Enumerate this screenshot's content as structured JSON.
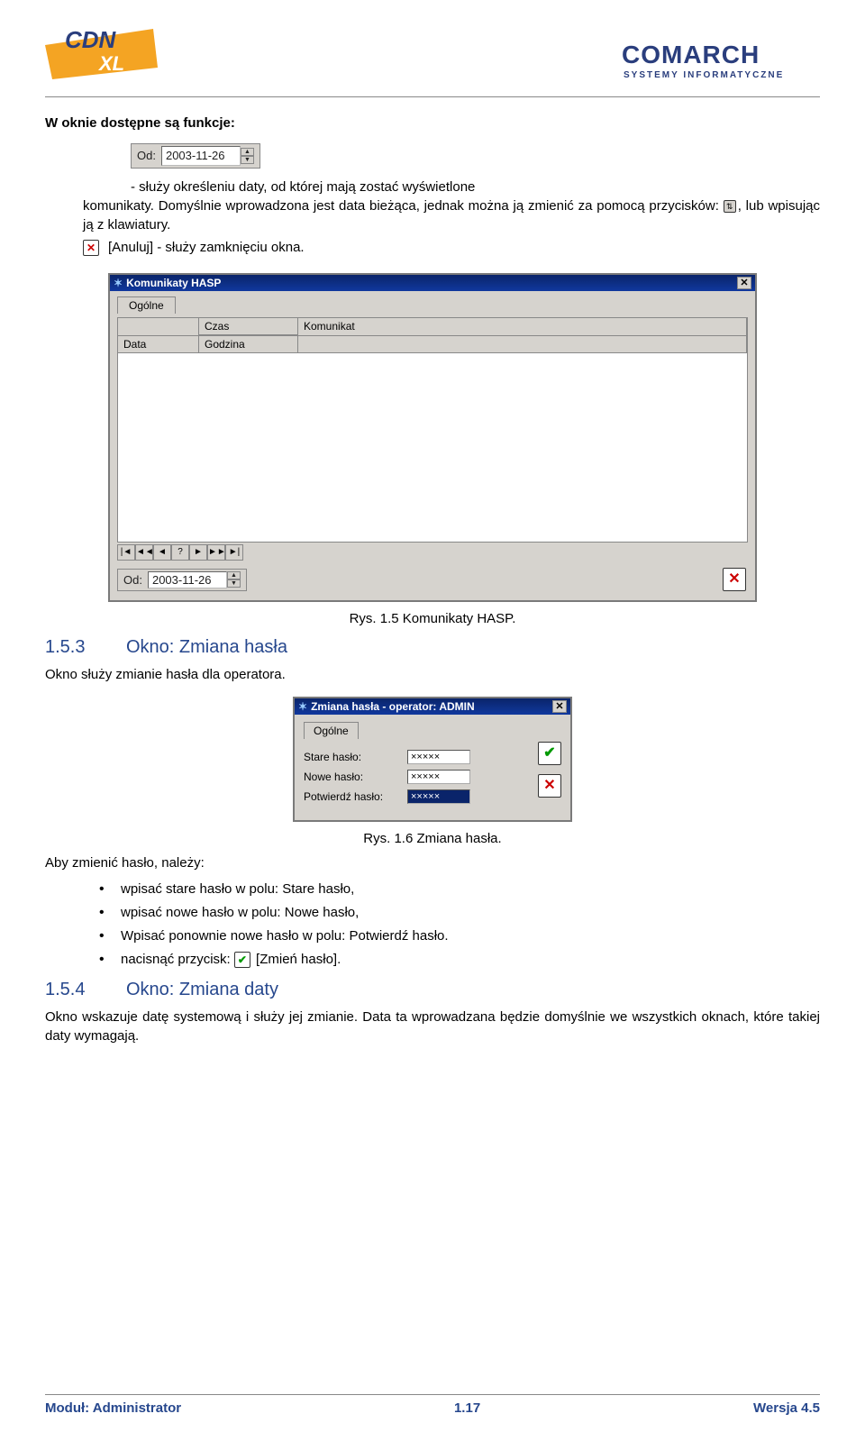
{
  "header": {
    "cdn_logo_top": "CDN",
    "cdn_logo_sub": "XL",
    "comarch_top": "COMARCH",
    "comarch_sub": "SYSTEMY INFORMATYCZNE"
  },
  "intro": {
    "lead": "W oknie dostępne są funkcje:",
    "od_label": "Od:",
    "od_value": "2003-11-26",
    "desc_line1": "- służy określeniu daty, od której mają zostać wyświetlone",
    "desc_line2_prefix": "komunikaty. Domyślnie wprowadzona jest data bieżąca, jednak można ją zmienić za pomocą przycisków: ",
    "desc_line2_suffix": ", lub wpisując ją z klawiatury.",
    "cancel_text": "[Anuluj] - służy zamknięciu okna."
  },
  "hasp_window": {
    "title": "Komunikaty HASP",
    "tab": "Ogólne",
    "col_czas": "Czas",
    "col_data": "Data",
    "col_godzina": "Godzina",
    "col_komunikat": "Komunikat",
    "nav": [
      "|◄",
      "◄◄",
      "◄",
      "?",
      "►",
      "►►",
      "►|"
    ],
    "footer_od_label": "Od:",
    "footer_od_value": "2003-11-26"
  },
  "fig1_caption": "Rys. 1.5 Komunikaty HASP.",
  "section153": {
    "num": "1.5.3",
    "title": "Okno: Zmiana hasła",
    "desc": "Okno służy zmianie hasła dla operatora."
  },
  "pw_dialog": {
    "title": "Zmiana hasła - operator: ADMIN",
    "tab": "Ogólne",
    "old_label": "Stare hasło:",
    "new_label": "Nowe hasło:",
    "conf_label": "Potwierdź hasło:",
    "mask": "×××××"
  },
  "fig2_caption": "Rys. 1.6 Zmiana hasła.",
  "steps": {
    "lead": "Aby zmienić hasło, należy:",
    "b1": "wpisać stare hasło w polu: Stare hasło,",
    "b2": "wpisać nowe hasło w polu: Nowe hasło,",
    "b3": "Wpisać ponownie nowe hasło w polu: Potwierdź hasło.",
    "b4_prefix": "nacisnąć przycisk: ",
    "b4_suffix": " [Zmień hasło]."
  },
  "section154": {
    "num": "1.5.4",
    "title": "Okno: Zmiana daty",
    "desc": "Okno wskazuje datę systemową i służy jej zmianie. Data ta wprowadzana będzie domyślnie we wszystkich oknach, które takiej daty wymagają."
  },
  "footer": {
    "left": "Moduł: Administrator",
    "mid": "1.17",
    "right": "Wersja 4.5"
  }
}
